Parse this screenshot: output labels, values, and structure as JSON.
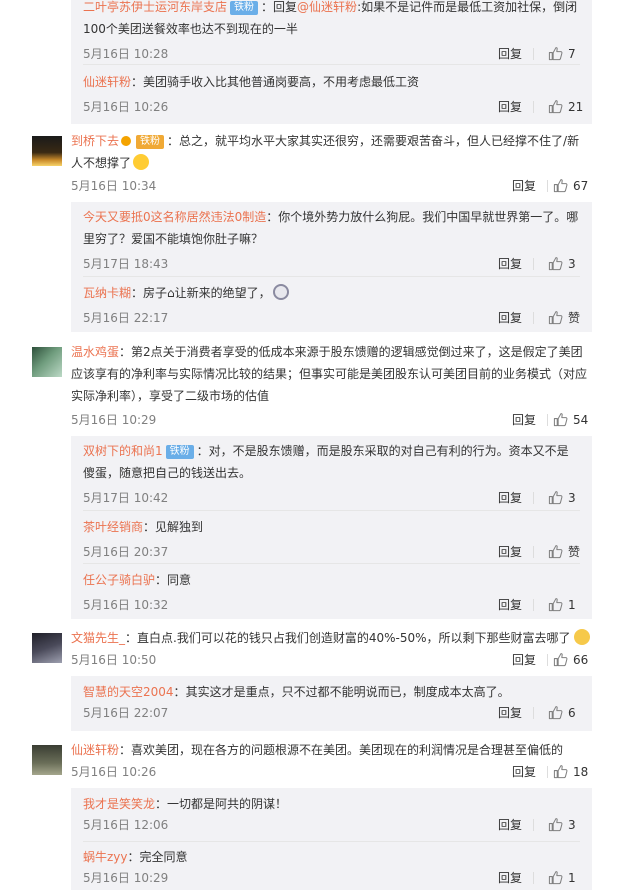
{
  "thread0": {
    "subs": [
      {
        "user": "二叶亭苏伊士运河东岸支店",
        "badge": "铁粉",
        "sep": "：",
        "text_pre": "回复",
        "mention": "@仙迷轩粉",
        "text": ":如果不是记件而是最低工资加社保，倒闭100个美团送餐效率也达不到现在的一半",
        "time": "5月16日 10:28",
        "reply": "回复",
        "likes": "7"
      },
      {
        "user": "仙迷轩粉",
        "sep": "：",
        "text": "美团骑手收入比其他普通岗要高，不用考虑最低工资",
        "time": "5月16日 10:26",
        "reply": "回复",
        "likes": "21"
      }
    ]
  },
  "thread1": {
    "user": "到桥下去",
    "sep": "：",
    "text": "总之，就平均水平大家其实还很穷，还需要艰苦奋斗，但人已经撑不住了/新人不想撑了",
    "time": "5月16日 10:34",
    "reply": "回复",
    "likes": "67",
    "subs": [
      {
        "user": "今天又要抵0这名称居然违法0制造",
        "sep": "：",
        "text": "你个境外势力放什么狗屁。我们中国早就世界第一了。哪里穷了？爱国不能填饱你肚子嘛？",
        "time": "5月17日 18:43",
        "reply": "回复",
        "likes": "3"
      },
      {
        "user": "瓦纳卡糊",
        "sep": "：",
        "text_pre": "房子",
        "text": "让新来的绝望了，",
        "time": "5月16日 22:17",
        "reply": "回复",
        "likes": "赞"
      }
    ]
  },
  "thread2": {
    "user": "温水鸡蛋",
    "sep": "：",
    "text": "第2点关于消费者享受的低成本来源于股东馈赠的逻辑感觉倒过来了，这是假定了美团应该享有的净利率与实际情况比较的结果；但事实可能是美团股东认可美团目前的业务模式（对应实际净利率），享受了二级市场的估值",
    "time": "5月16日 10:29",
    "reply": "回复",
    "likes": "54",
    "subs": [
      {
        "user": "双树下的和尚1",
        "badge": "铁粉",
        "sep": "：",
        "text": "对，不是股东馈赠，而是股东采取的对自己有利的行为。资本又不是傻蛋，随意把自己的钱送出去。",
        "time": "5月17日 10:42",
        "reply": "回复",
        "likes": "3"
      },
      {
        "user": "茶叶经销商",
        "sep": "：",
        "text": "见解独到",
        "time": "5月16日 20:37",
        "reply": "回复",
        "likes": "赞"
      },
      {
        "user": "任公子骑白驴",
        "sep": "：",
        "text": "同意",
        "time": "5月16日 10:32",
        "reply": "回复",
        "likes": "1"
      }
    ]
  },
  "thread3": {
    "user": "文猫先生_",
    "sep": "：",
    "text": "直白点.我们可以花的钱只占我们创造财富的40%-50%，所以剩下那些财富去哪了",
    "time": "5月16日 10:50",
    "reply": "回复",
    "likes": "66",
    "subs": [
      {
        "user": "智慧的天空2004",
        "sep": "：",
        "text": "其实这才是重点，只不过都不能明说而已，制度成本太高了。",
        "time": "5月16日 22:07",
        "reply": "回复",
        "likes": "6"
      }
    ]
  },
  "thread4": {
    "user": "仙迷轩粉",
    "sep": "：",
    "text": "喜欢美团，现在各方的问题根源不在美团。美团现在的利润情况是合理甚至偏低的",
    "time": "5月16日 10:26",
    "reply": "回复",
    "likes": "18",
    "subs": [
      {
        "user": "我才是笑笑龙",
        "sep": "：",
        "text": "一切都是阿共的阴谋！",
        "time": "5月16日 12:06",
        "reply": "回复",
        "likes": "3"
      },
      {
        "user": "蜗牛zyy",
        "sep": "：",
        "text": "完全同意",
        "time": "5月16日 10:29",
        "reply": "回复",
        "likes": "1"
      }
    ]
  },
  "colors": {
    "username": "#eb7350",
    "mention": "#eb7350",
    "meta": "#808080",
    "sub_bg": "#f2f2f5",
    "badge_blue": "#6aaee8",
    "badge_gold": "#f0a935"
  },
  "icons": {
    "like": "thumbs-up-icon",
    "verified": "verified-icon",
    "house": "house-emoji-icon",
    "dog": "dog-emoji-icon",
    "cat": "cat-emoji-icon",
    "tongue": "tongue-emoji-icon"
  }
}
